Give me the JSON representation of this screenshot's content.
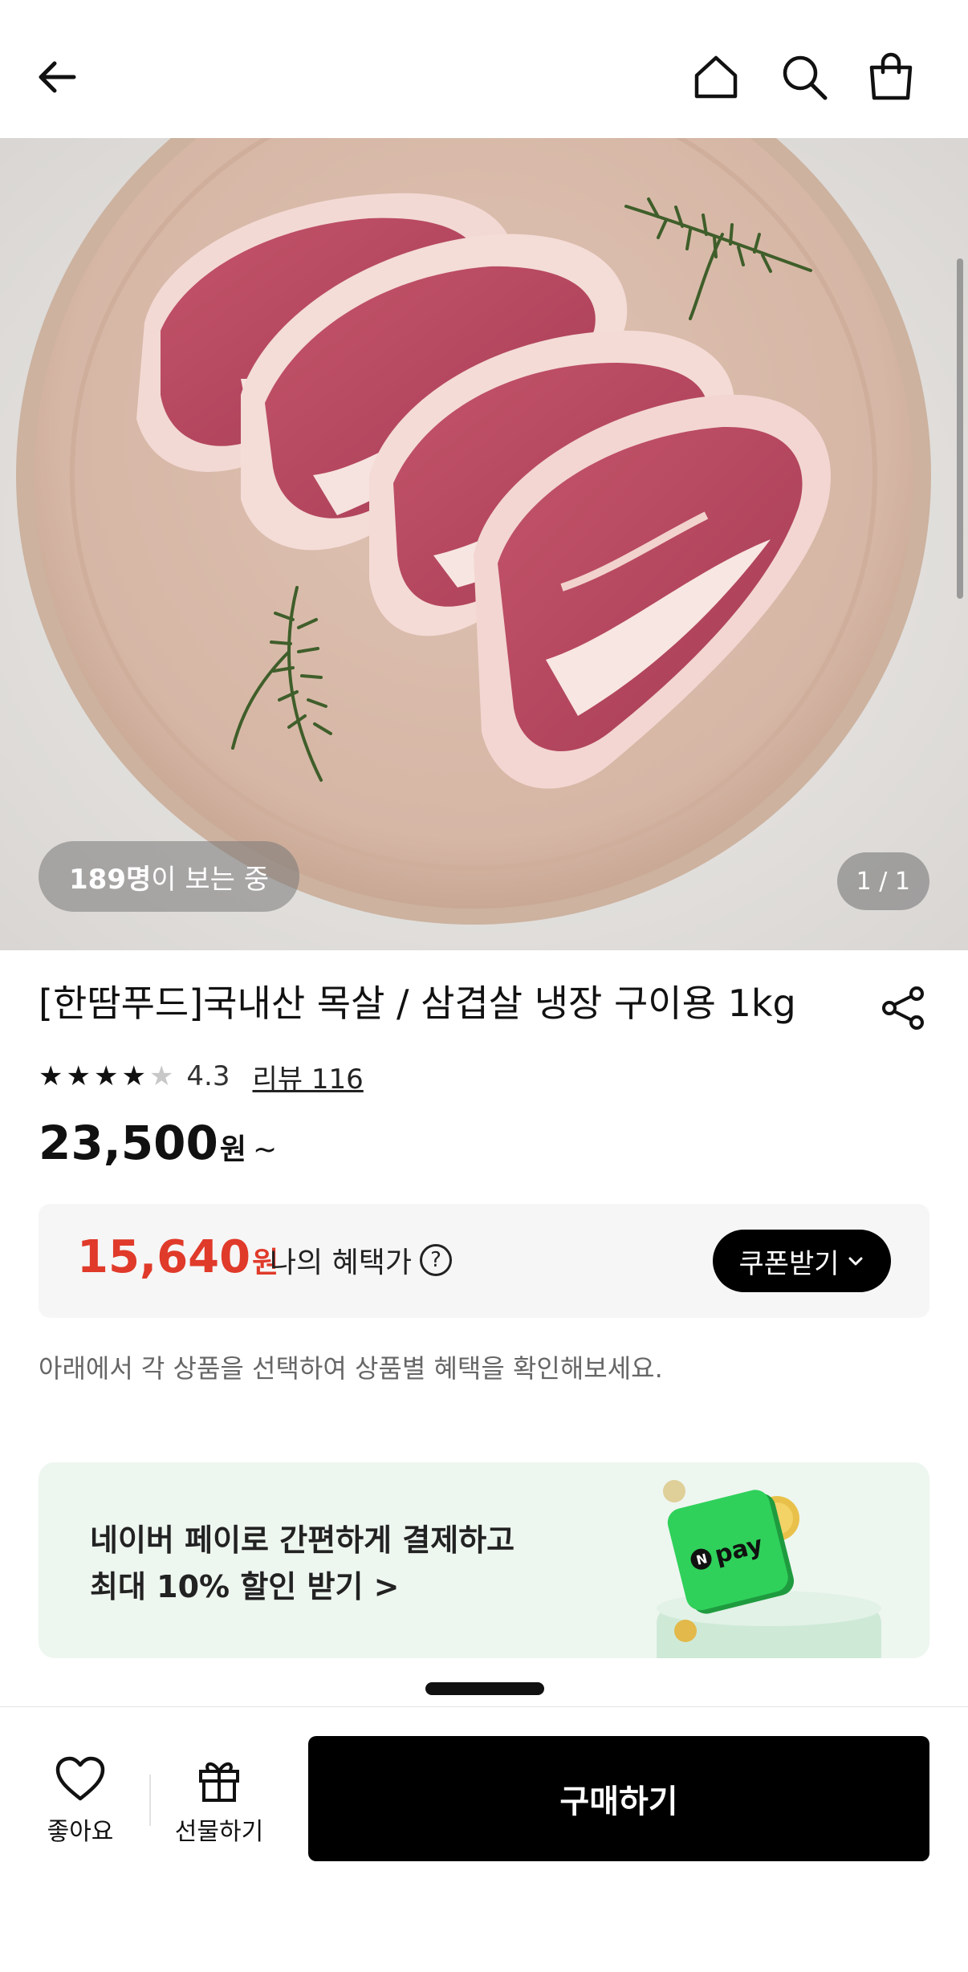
{
  "nav": {
    "back_icon": "arrow-left-icon",
    "home_icon": "home-icon",
    "search_icon": "search-icon",
    "cart_icon": "shopping-bag-icon"
  },
  "gallery": {
    "viewers_count": "189명",
    "viewers_suffix": "이 보는 중",
    "pager": "1 / 1"
  },
  "product": {
    "title": "[한땀푸드]국내산 목살 / 삼겹살 냉장 구이용 1kg",
    "rating": "4.3",
    "rating_value": 4.3,
    "rating_max": 5,
    "review_label": "리뷰 116",
    "price": "23,500",
    "price_unit": "원",
    "price_suffix": "~"
  },
  "benefit": {
    "price": "15,640",
    "price_unit": "원",
    "label": "나의 혜택가",
    "help_glyph": "?",
    "coupon_button": "쿠폰받기"
  },
  "notice": "아래에서 각 상품을 선택하여 상품별 혜택을 확인해보세요.",
  "banner": {
    "line1": "네이버 페이로 간편하게 결제하고",
    "line2": "최대 10% 할인 받기 >",
    "badge_text": "pay",
    "badge_letter": "N"
  },
  "bottom": {
    "like_label": "좋아요",
    "gift_label": "선물하기",
    "buy_label": "구매하기"
  },
  "colors": {
    "accent_red": "#e03a2a",
    "primary_black": "#000000",
    "npay_green": "#2fd15a"
  }
}
